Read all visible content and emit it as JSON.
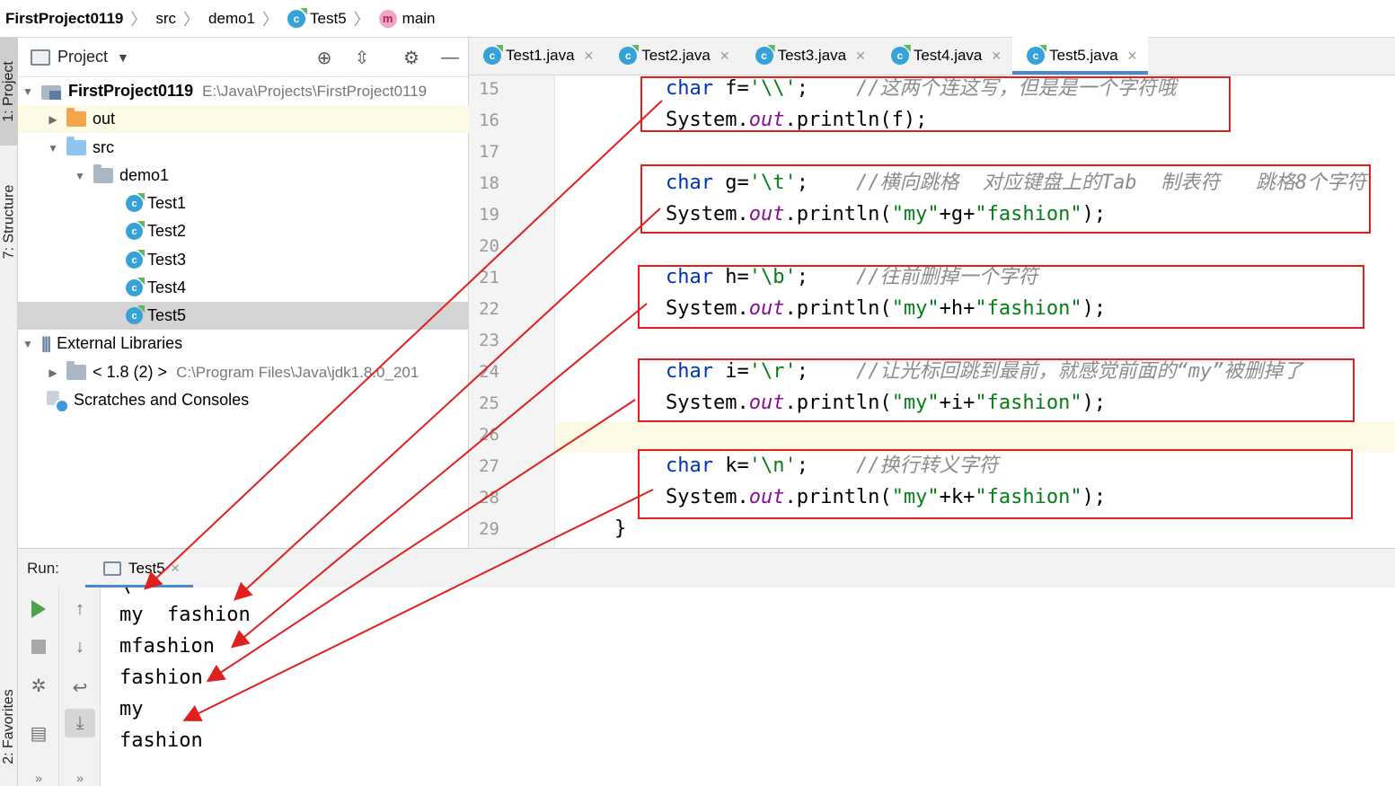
{
  "breadcrumb": {
    "project": "FirstProject0119",
    "src": "src",
    "package": "demo1",
    "class": "Test5",
    "method": "main"
  },
  "left_strip": {
    "project_tab": "1: Project",
    "structure_tab": "7: Structure",
    "favorites_tab": "2: Favorites"
  },
  "project_panel": {
    "title": "Project",
    "tree": {
      "root_name": "FirstProject0119",
      "root_path": "E:\\Java\\Projects\\FirstProject0119",
      "out": "out",
      "src": "src",
      "demo1": "demo1",
      "classes": [
        "Test1",
        "Test2",
        "Test3",
        "Test4",
        "Test5"
      ],
      "external_libraries": "External Libraries",
      "jdk_name": "< 1.8 (2) >",
      "jdk_path": "C:\\Program Files\\Java\\jdk1.8.0_201",
      "scratches": "Scratches and Consoles"
    }
  },
  "editor_tabs": [
    "Test1.java",
    "Test2.java",
    "Test3.java",
    "Test4.java",
    "Test5.java"
  ],
  "active_tab": "Test5.java",
  "code": {
    "line_numbers": [
      "15",
      "16",
      "17",
      "18",
      "19",
      "20",
      "21",
      "22",
      "23",
      "24",
      "25",
      "26",
      "27",
      "28",
      "29"
    ],
    "l15": {
      "kw": "char",
      "rest": " f=",
      "str": "'\\\\'",
      "end": ";",
      "comment": "//这两个连这写，但是是一个字符哦"
    },
    "l16": {
      "a": "System.",
      "field": "out",
      "b": ".println(f);"
    },
    "l18": {
      "kw": "char",
      "rest": " g=",
      "str": "'\\t'",
      "end": ";",
      "comment": "//横向跳格  对应键盘上的Tab  制表符   跳格8个字符"
    },
    "l19": {
      "a": "System.",
      "field": "out",
      "b": ".println(",
      "s1": "\"my\"",
      "mid": "+g+",
      "s2": "\"fashion\"",
      "end": ");"
    },
    "l21": {
      "kw": "char",
      "rest": " h=",
      "str": "'\\b'",
      "end": ";",
      "comment": "//往前删掉一个字符"
    },
    "l22": {
      "a": "System.",
      "field": "out",
      "b": ".println(",
      "s1": "\"my\"",
      "mid": "+h+",
      "s2": "\"fashion\"",
      "end": ");"
    },
    "l24": {
      "kw": "char",
      "rest": " i=",
      "str": "'\\r'",
      "end": ";",
      "comment": "//让光标回跳到最前，就感觉前面的“my”被删掉了"
    },
    "l25": {
      "a": "System.",
      "field": "out",
      "b": ".println(",
      "s1": "\"my\"",
      "mid": "+i+",
      "s2": "\"fashion\"",
      "end": ");"
    },
    "l27": {
      "kw": "char",
      "rest": " k=",
      "str": "'\\n'",
      "end": ";",
      "comment": "//换行转义字符"
    },
    "l28": {
      "a": "System.",
      "field": "out",
      "b": ".println(",
      "s1": "\"my\"",
      "mid": "+k+",
      "s2": "\"fashion\"",
      "end": ");"
    },
    "l29": "}"
  },
  "run_panel": {
    "label": "Run:",
    "tab": "Test5",
    "output": [
      "\\",
      "my  fashion",
      "mfashion",
      "fashion",
      "my",
      "fashion"
    ]
  },
  "colors": {
    "keyword": "#0033b3",
    "string": "#067d17",
    "field": "#871094",
    "comment": "#8c8c8c",
    "annotation_red": "#e01f1f",
    "tab_underline": "#4a88c7"
  }
}
